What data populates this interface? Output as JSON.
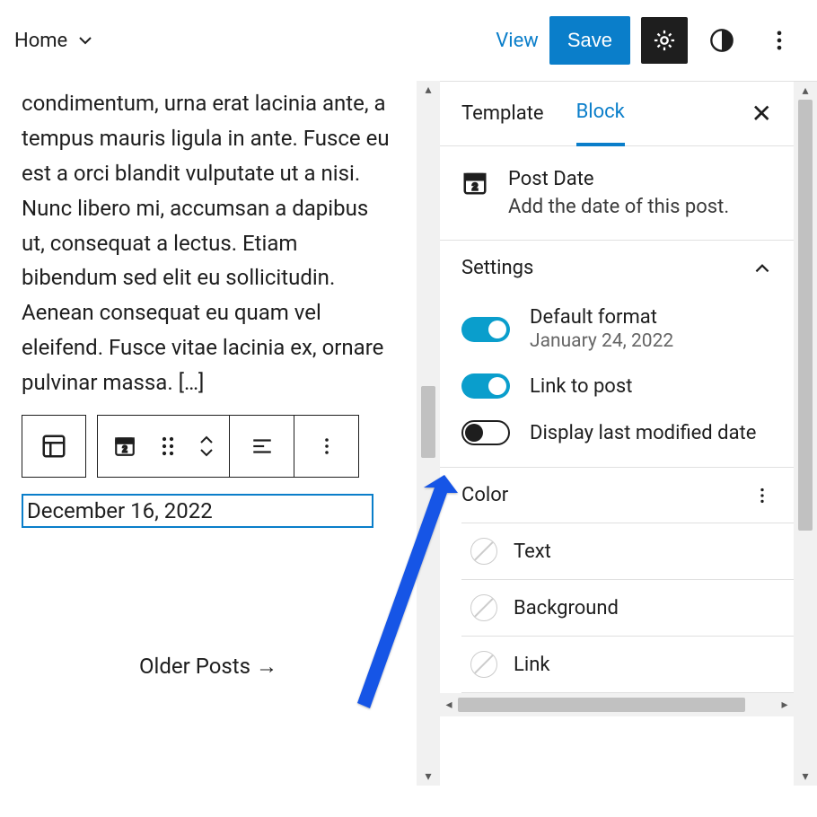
{
  "topbar": {
    "home_label": "Home",
    "view_label": "View",
    "save_label": "Save"
  },
  "editor": {
    "paragraph": "condimentum, urna erat lacinia ante, a tempus mauris ligula in ante. Fusce eu est a orci blandit vulputate ut a nisi. Nunc libero mi, accumsan a dapibus ut, consequat a lectus. Etiam bibendum sed elit eu sollicitudin. Aenean consequat eu quam vel eleifend. Fusce vitae lacinia ex, ornare pulvinar massa. […]",
    "date_value": "December 16, 2022",
    "older_posts": "Older Posts  →"
  },
  "sidebar": {
    "tabs": {
      "template": "Template",
      "block": "Block"
    },
    "block_title": "Post Date",
    "block_desc": "Add the date of this post.",
    "settings_label": "Settings",
    "default_format_label": "Default format",
    "default_format_value": "January 24, 2022",
    "link_to_post_label": "Link to post",
    "display_modified_label": "Display last modified date",
    "color_label": "Color",
    "color_items": {
      "text": "Text",
      "background": "Background",
      "link": "Link"
    }
  }
}
